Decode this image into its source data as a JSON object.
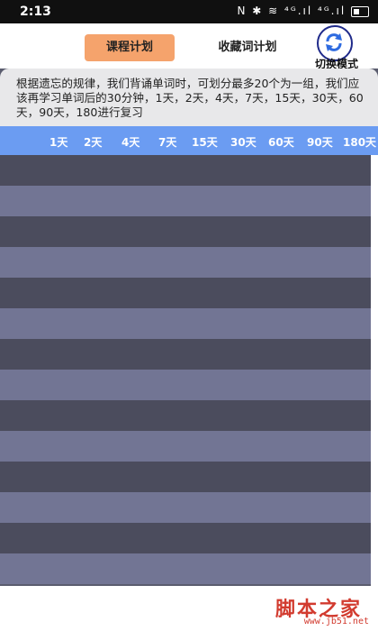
{
  "status_bar": {
    "time": "2:13",
    "icons": [
      "nfc-icon",
      "bluetooth-icon",
      "wifi-icon",
      "signal-icon",
      "signal-icon",
      "battery-icon"
    ],
    "nfc": "N",
    "bluetooth": "✱",
    "wifi": "≋",
    "signal_1": "⁴ᴳ.ıl",
    "signal_2": "⁴ᴳ.ıl"
  },
  "header": {
    "tab_course": "课程计划",
    "tab_favorites": "收藏词计划",
    "switch_label": "切换模式",
    "active_color": "#f5a36c"
  },
  "description": "根据遗忘的规律，我们背诵单词时，可划分最多20个为一组，我们应该再学习单词后的30分钟，1天，2天，4天，7天，15天，30天，60天，90天，180进行复习",
  "schedule_columns": [
    "1天",
    "2天",
    "4天",
    "7天",
    "15天",
    "30天",
    "60天",
    "90天",
    "180天"
  ],
  "header_color": "#6b9cf2",
  "row_colors": {
    "dark": "#4b4c5d",
    "light": "#727594"
  },
  "row_count": 14,
  "watermark": {
    "text": "脚本之家",
    "url": "www.jb51.net"
  }
}
